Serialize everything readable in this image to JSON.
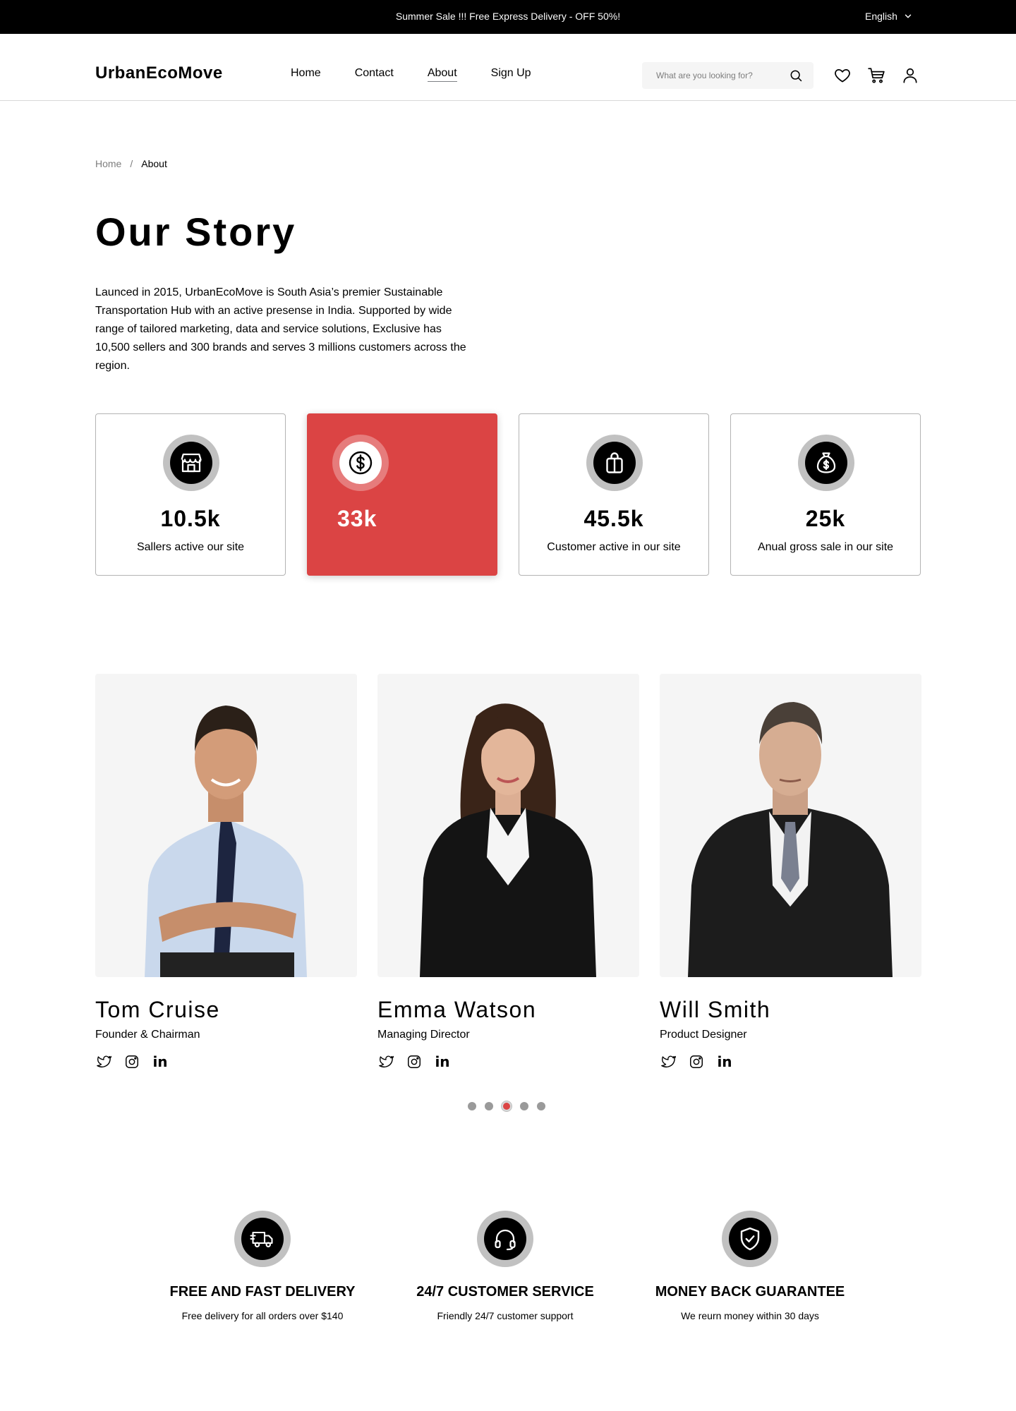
{
  "topbar": {
    "message": "Summer Sale !!! Free Express Delivery - OFF 50%!",
    "language": "English"
  },
  "header": {
    "logo": "UrbanEcoMove",
    "nav": [
      "Home",
      "Contact",
      "About",
      "Sign Up"
    ],
    "active_nav": "About",
    "search_placeholder": "What are you looking for?"
  },
  "breadcrumb": {
    "home": "Home",
    "separator": "/",
    "current": "About"
  },
  "story": {
    "title": "Our Story",
    "text": "Launced in 2015, UrbanEcoMove is South Asia’s premier Sustainable Transportation Hub with an active presense in India. Supported by wide range of tailored marketing, data and service solutions, Exclusive has 10,500 sellers and 300 brands and serves 3 millions customers across the region."
  },
  "stats": [
    {
      "icon": "shop-icon",
      "value": "10.5k",
      "label": "Sallers active our site"
    },
    {
      "icon": "dollar-icon",
      "value": "33k",
      "label": ""
    },
    {
      "icon": "shopping-bag-icon",
      "value": "45.5k",
      "label": "Customer active in our site"
    },
    {
      "icon": "money-bag-icon",
      "value": "25k",
      "label": "Anual gross sale in our site"
    }
  ],
  "team": [
    {
      "name": "Tom Cruise",
      "role": "Founder & Chairman",
      "social": {
        "linkedin": "in"
      }
    },
    {
      "name": "Emma Watson",
      "role": "Managing Director",
      "social": {
        "linkedin": "in"
      }
    },
    {
      "name": "Will Smith",
      "role": "Product Designer",
      "social": {
        "linkedin": "in"
      }
    }
  ],
  "carousel": {
    "count": 5,
    "active": 3
  },
  "services": [
    {
      "icon": "delivery-truck-icon",
      "title": "FREE AND FAST DELIVERY",
      "subtitle": "Free delivery for all orders over $140"
    },
    {
      "icon": "headset-icon",
      "title": "24/7 CUSTOMER SERVICE",
      "subtitle": "Friendly 24/7 customer support"
    },
    {
      "icon": "shield-check-icon",
      "title": "MONEY BACK GUARANTEE",
      "subtitle": "We reurn money within 30 days"
    }
  ],
  "colors": {
    "accent": "#DB4444",
    "topbar_bg": "#000000",
    "card_bg": "#F5F5F5",
    "icon_ring": "#C1C1C1"
  }
}
